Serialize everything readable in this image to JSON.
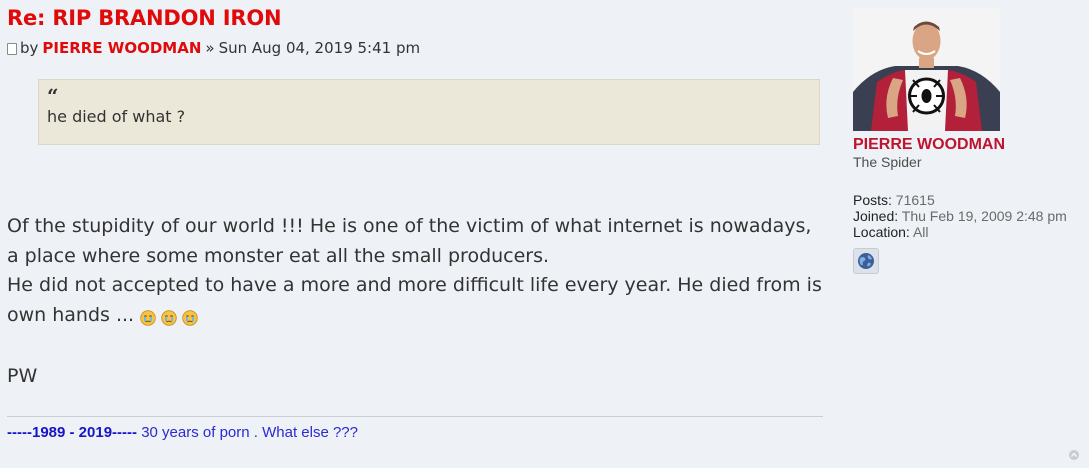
{
  "post": {
    "title": "Re: RIP BRANDON IRON",
    "by_label": "by",
    "author": "PIERRE WOODMAN",
    "separator": "»",
    "date": "Sun Aug 04, 2019 5:41 pm"
  },
  "quote": {
    "mark": "“",
    "text": "he died of what ?"
  },
  "content": {
    "line1": "Of the stupidity of our world !!! He is one of the victim of what internet is nowadays, a place where some monster eat all the small producers.",
    "line2": "He did not accepted to have a more and more difficult life every year. He died from is own hands ...",
    "smiley_icon": "crying-face-icon",
    "sign": "PW"
  },
  "signature": {
    "years": "-----1989 - 2019-----",
    "text": " 30 years of porn . What else ???"
  },
  "profile": {
    "avatar_icon": "spider-superhero-avatar",
    "username": "PIERRE WOODMAN",
    "rank": "The Spider",
    "posts_label": "Posts:",
    "posts_value": "71615",
    "joined_label": "Joined:",
    "joined_value": "Thu Feb 19, 2009 2:48 pm",
    "location_label": "Location:",
    "location_value": "All",
    "website_icon": "globe-icon"
  },
  "colors": {
    "title": "#e00a0a",
    "username": "#c0142e",
    "signature": "#2a2ad0",
    "background": "#eef1f6",
    "quote_bg": "#ebe7d9"
  }
}
